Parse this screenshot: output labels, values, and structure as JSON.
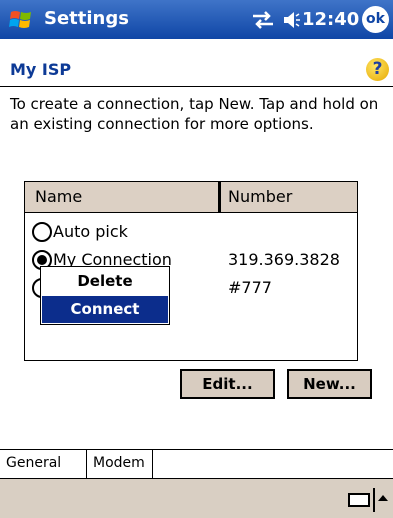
{
  "titlebar": {
    "title": "Settings",
    "time": "12:40",
    "ok_label": "ok"
  },
  "subheader": {
    "title": "My ISP",
    "help_symbol": "?"
  },
  "instructions": "To create a connection, tap New. Tap and hold on an existing connection for more options.",
  "list": {
    "headers": {
      "name": "Name",
      "number": "Number"
    },
    "rows": [
      {
        "name": "Auto pick",
        "number": "",
        "selected": false
      },
      {
        "name": "My Connection",
        "number": "319.369.3828",
        "selected": true
      },
      {
        "name": "",
        "number": "#777",
        "selected": false
      }
    ]
  },
  "context_menu": {
    "items": [
      "Delete",
      "Connect"
    ],
    "highlighted": "Connect"
  },
  "buttons": {
    "edit": "Edit...",
    "new": "New..."
  },
  "tabs": [
    {
      "label": "General"
    },
    {
      "label": "Modem"
    }
  ],
  "colors": {
    "titlebar": "#1046a6",
    "subtitle": "#0d3a96",
    "menu_highlight": "#0c2d8c",
    "panel": "#d9cfc3"
  }
}
